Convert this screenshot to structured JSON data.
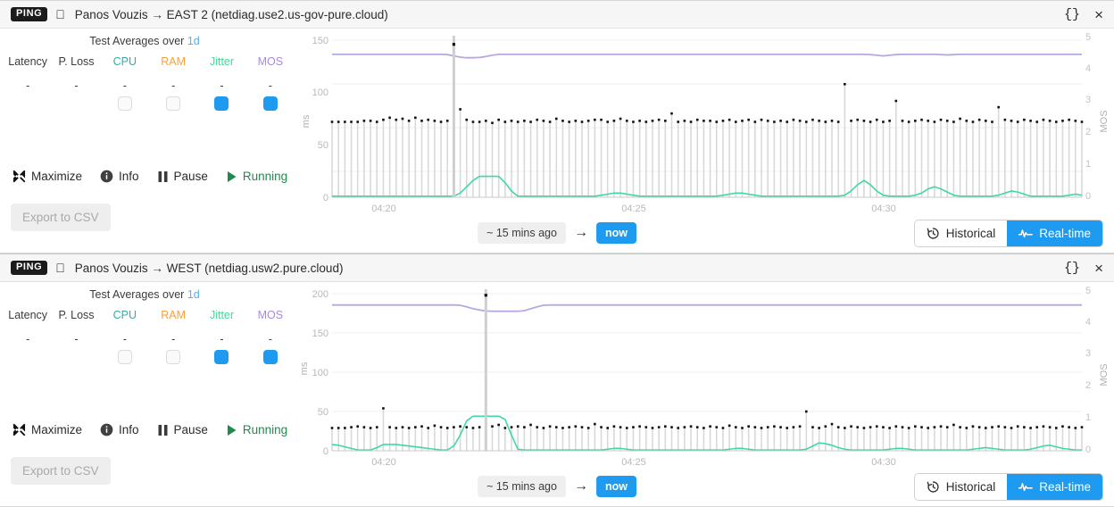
{
  "panels": [
    {
      "titlebar": {
        "badge": "PING",
        "os_icon": "apple-icon",
        "title": "Panos Vouzis → EAST 2 (netdiag.use2.us-gov-pure.cloud)",
        "json_button": "{}",
        "close_button": "×"
      },
      "averages": {
        "label_prefix": "Test Averages over",
        "duration": "1d",
        "columns": [
          {
            "label": "Latency",
            "color": "#3b3b3b",
            "value": "-",
            "checkbox": null
          },
          {
            "label": "P. Loss",
            "color": "#3b3b3b",
            "value": "-",
            "checkbox": null
          },
          {
            "label": "CPU",
            "color": "#3aa8a8",
            "value": "-",
            "checkbox": "off"
          },
          {
            "label": "RAM",
            "color": "#f6a13c",
            "value": "-",
            "checkbox": "off"
          },
          {
            "label": "Jitter",
            "color": "#42d99a",
            "value": "-",
            "checkbox": "on"
          },
          {
            "label": "MOS",
            "color": "#a98ae0",
            "value": "-",
            "checkbox": "on"
          }
        ]
      },
      "actions": [
        {
          "icon": "maximize-icon",
          "label": "Maximize",
          "state": "normal"
        },
        {
          "icon": "info-icon",
          "label": "Info",
          "state": "normal"
        },
        {
          "icon": "pause-icon",
          "label": "Pause",
          "state": "normal"
        },
        {
          "icon": "play-icon",
          "label": "Running",
          "state": "running"
        }
      ],
      "export_label": "Export to CSV",
      "footer": {
        "time_from": "~ 15 mins ago",
        "arrow": "→",
        "time_to": "now",
        "historical_label": "Historical",
        "historical_icon": "history-clock-icon",
        "realtime_label": "Real-time",
        "realtime_icon": "pulse-icon",
        "active_mode": "Real-time"
      },
      "chart_data": {
        "type": "line",
        "title": "",
        "xlabel": "",
        "ylabel": "ms",
        "y2label": "MOS",
        "ylim": [
          0,
          150
        ],
        "y2lim": [
          0,
          5
        ],
        "yticks": [
          0,
          50,
          100,
          150
        ],
        "y2ticks": [
          0,
          1,
          2,
          3,
          4,
          5
        ],
        "xticks": [
          "04:20",
          "04:25",
          "04:30"
        ],
        "grid": true,
        "legend_position": "none",
        "series": [
          {
            "name": "Latency",
            "color": "#d9d9d9",
            "marker_color": "#111111",
            "type": "stem",
            "values": [
              72,
              72,
              72,
              72,
              72,
              73,
              73,
              72,
              74,
              76,
              74,
              75,
              73,
              76,
              73,
              74,
              73,
              72,
              73,
              146,
              84,
              74,
              72,
              72,
              73,
              71,
              74,
              72,
              73,
              72,
              73,
              72,
              74,
              73,
              72,
              75,
              73,
              72,
              73,
              72,
              73,
              74,
              74,
              72,
              73,
              75,
              73,
              72,
              73,
              72,
              73,
              74,
              73,
              80,
              72,
              73,
              72,
              74,
              73,
              73,
              72,
              73,
              74,
              72,
              73,
              74,
              72,
              74,
              73,
              72,
              73,
              72,
              74,
              73,
              72,
              74,
              73,
              72,
              73,
              72,
              108,
              73,
              74,
              73,
              72,
              74,
              72,
              73,
              92,
              73,
              72,
              73,
              74,
              73,
              72,
              74,
              73,
              72,
              75,
              73,
              72,
              74,
              73,
              72,
              86,
              74,
              73,
              72,
              74,
              73,
              72,
              74,
              73,
              72,
              73,
              74,
              73,
              72
            ]
          },
          {
            "name": "MOS",
            "color": "#b9a8e0",
            "type": "line",
            "values": [
              4.55,
              4.55,
              4.55,
              4.55,
              4.55,
              4.55,
              4.55,
              4.55,
              4.55,
              4.55,
              4.55,
              4.55,
              4.55,
              4.55,
              4.55,
              4.55,
              4.55,
              4.55,
              4.54,
              4.5,
              4.46,
              4.44,
              4.44,
              4.45,
              4.48,
              4.52,
              4.55,
              4.55,
              4.55,
              4.55,
              4.55,
              4.55,
              4.55,
              4.55,
              4.55,
              4.55,
              4.55,
              4.55,
              4.55,
              4.55,
              4.55,
              4.55,
              4.55,
              4.55,
              4.55,
              4.55,
              4.55,
              4.55,
              4.55,
              4.55,
              4.55,
              4.55,
              4.55,
              4.55,
              4.55,
              4.55,
              4.55,
              4.55,
              4.55,
              4.55,
              4.55,
              4.55,
              4.55,
              4.55,
              4.55,
              4.55,
              4.55,
              4.55,
              4.55,
              4.55,
              4.55,
              4.55,
              4.55,
              4.55,
              4.55,
              4.55,
              4.55,
              4.55,
              4.55,
              4.55,
              4.55,
              4.55,
              4.55,
              4.55,
              4.54,
              4.52,
              4.5,
              4.52,
              4.54,
              4.55,
              4.55,
              4.55,
              4.55,
              4.55,
              4.55,
              4.54,
              4.53,
              4.54,
              4.55,
              4.55,
              4.55,
              4.55,
              4.55,
              4.55,
              4.55,
              4.55,
              4.55,
              4.55,
              4.55,
              4.55,
              4.55,
              4.55,
              4.55,
              4.55,
              4.55,
              4.55,
              4.55,
              4.55
            ]
          },
          {
            "name": "Jitter",
            "color": "#3fd9a0",
            "type": "line",
            "values": [
              1,
              1,
              1,
              1,
              1,
              1,
              1,
              1,
              1,
              1,
              1,
              1,
              1,
              1,
              1,
              1,
              1,
              1,
              1,
              1,
              4,
              10,
              16,
              20,
              20,
              20,
              20,
              14,
              6,
              1,
              1,
              1,
              1,
              1,
              1,
              1,
              1,
              1,
              1,
              1,
              1,
              1,
              2,
              3,
              4,
              4,
              3,
              2,
              1,
              1,
              1,
              1,
              1,
              1,
              1,
              1,
              1,
              1,
              1,
              1,
              1,
              2,
              3,
              4,
              4,
              3,
              2,
              1,
              1,
              1,
              1,
              1,
              1,
              1,
              1,
              1,
              1,
              1,
              1,
              1,
              2,
              6,
              12,
              16,
              12,
              6,
              2,
              1,
              1,
              1,
              1,
              2,
              4,
              8,
              10,
              8,
              5,
              2,
              1,
              1,
              1,
              1,
              1,
              1,
              2,
              4,
              6,
              5,
              3,
              1,
              1,
              1,
              1,
              1,
              1,
              2,
              3,
              2
            ]
          }
        ]
      }
    },
    {
      "titlebar": {
        "badge": "PING",
        "os_icon": "apple-icon",
        "title": "Panos Vouzis → WEST (netdiag.usw2.pure.cloud)",
        "json_button": "{}",
        "close_button": "×"
      },
      "averages": {
        "label_prefix": "Test Averages over",
        "duration": "1d",
        "columns": [
          {
            "label": "Latency",
            "color": "#3b3b3b",
            "value": "-",
            "checkbox": null
          },
          {
            "label": "P. Loss",
            "color": "#3b3b3b",
            "value": "-",
            "checkbox": null
          },
          {
            "label": "CPU",
            "color": "#3aa8a8",
            "value": "-",
            "checkbox": "off"
          },
          {
            "label": "RAM",
            "color": "#f6a13c",
            "value": "-",
            "checkbox": "off"
          },
          {
            "label": "Jitter",
            "color": "#42d99a",
            "value": "-",
            "checkbox": "on"
          },
          {
            "label": "MOS",
            "color": "#a98ae0",
            "value": "-",
            "checkbox": "on"
          }
        ]
      },
      "actions": [
        {
          "icon": "maximize-icon",
          "label": "Maximize",
          "state": "normal"
        },
        {
          "icon": "info-icon",
          "label": "Info",
          "state": "normal"
        },
        {
          "icon": "pause-icon",
          "label": "Pause",
          "state": "normal"
        },
        {
          "icon": "play-icon",
          "label": "Running",
          "state": "running"
        }
      ],
      "export_label": "Export to CSV",
      "footer": {
        "time_from": "~ 15 mins ago",
        "arrow": "→",
        "time_to": "now",
        "historical_label": "Historical",
        "historical_icon": "history-clock-icon",
        "realtime_label": "Real-time",
        "realtime_icon": "pulse-icon",
        "active_mode": "Real-time"
      },
      "chart_data": {
        "type": "line",
        "title": "",
        "xlabel": "",
        "ylabel": "ms",
        "y2label": "MOS",
        "ylim": [
          0,
          200
        ],
        "y2lim": [
          0,
          5
        ],
        "yticks": [
          0,
          50,
          100,
          150,
          200
        ],
        "y2ticks": [
          0,
          1,
          2,
          3,
          4,
          5
        ],
        "xticks": [
          "04:20",
          "04:25",
          "04:30"
        ],
        "grid": true,
        "legend_position": "none",
        "series": [
          {
            "name": "Latency",
            "color": "#d9d9d9",
            "marker_color": "#111111",
            "type": "stem",
            "values": [
              29,
              29,
              29,
              30,
              31,
              30,
              29,
              30,
              54,
              30,
              29,
              30,
              29,
              30,
              31,
              29,
              32,
              30,
              29,
              30,
              31,
              30,
              29,
              30,
              198,
              31,
              33,
              29,
              30,
              31,
              30,
              33,
              30,
              29,
              31,
              30,
              29,
              30,
              31,
              30,
              29,
              34,
              30,
              29,
              31,
              30,
              29,
              30,
              31,
              30,
              29,
              30,
              31,
              30,
              29,
              30,
              31,
              30,
              29,
              31,
              30,
              29,
              32,
              30,
              29,
              31,
              30,
              29,
              30,
              31,
              30,
              29,
              30,
              31,
              50,
              30,
              29,
              31,
              34,
              30,
              29,
              31,
              30,
              29,
              30,
              31,
              30,
              29,
              31,
              30,
              29,
              31,
              30,
              29,
              30,
              31,
              30,
              33,
              30,
              29,
              31,
              30,
              29,
              30,
              31,
              30,
              29,
              31,
              30,
              29,
              30,
              31,
              30,
              29,
              31,
              30,
              29,
              30
            ]
          },
          {
            "name": "MOS",
            "color": "#b9a8e0",
            "type": "line",
            "values": [
              4.64,
              4.64,
              4.64,
              4.64,
              4.64,
              4.64,
              4.64,
              4.64,
              4.64,
              4.64,
              4.64,
              4.64,
              4.64,
              4.64,
              4.64,
              4.64,
              4.64,
              4.64,
              4.64,
              4.64,
              4.63,
              4.58,
              4.52,
              4.48,
              4.45,
              4.44,
              4.44,
              4.44,
              4.44,
              4.44,
              4.46,
              4.52,
              4.58,
              4.63,
              4.64,
              4.64,
              4.64,
              4.64,
              4.64,
              4.64,
              4.64,
              4.64,
              4.64,
              4.64,
              4.64,
              4.64,
              4.64,
              4.64,
              4.64,
              4.64,
              4.64,
              4.64,
              4.64,
              4.64,
              4.64,
              4.64,
              4.64,
              4.64,
              4.64,
              4.64,
              4.64,
              4.64,
              4.64,
              4.64,
              4.64,
              4.64,
              4.64,
              4.64,
              4.64,
              4.64,
              4.64,
              4.64,
              4.64,
              4.64,
              4.64,
              4.64,
              4.64,
              4.64,
              4.64,
              4.64,
              4.64,
              4.64,
              4.64,
              4.64,
              4.64,
              4.64,
              4.64,
              4.64,
              4.64,
              4.64,
              4.64,
              4.64,
              4.64,
              4.64,
              4.64,
              4.64,
              4.64,
              4.64,
              4.64,
              4.64,
              4.64,
              4.64,
              4.64,
              4.64,
              4.64,
              4.64,
              4.64,
              4.64,
              4.64,
              4.64,
              4.64,
              4.64,
              4.64,
              4.64,
              4.64,
              4.64,
              4.64,
              4.64
            ]
          },
          {
            "name": "Jitter",
            "color": "#3fd9a0",
            "type": "line",
            "values": [
              8,
              7,
              5,
              3,
              1,
              1,
              1,
              4,
              8,
              8,
              8,
              7,
              6,
              5,
              4,
              3,
              2,
              1,
              1,
              6,
              20,
              38,
              44,
              44,
              44,
              44,
              44,
              40,
              20,
              2,
              1,
              1,
              1,
              1,
              1,
              1,
              1,
              1,
              1,
              1,
              1,
              1,
              1,
              2,
              3,
              3,
              2,
              1,
              1,
              1,
              1,
              1,
              1,
              1,
              1,
              1,
              1,
              1,
              1,
              1,
              1,
              1,
              2,
              3,
              3,
              2,
              1,
              1,
              1,
              1,
              1,
              1,
              1,
              1,
              2,
              6,
              10,
              9,
              7,
              4,
              2,
              1,
              1,
              1,
              1,
              1,
              1,
              2,
              3,
              3,
              2,
              1,
              1,
              1,
              1,
              1,
              1,
              1,
              1,
              1,
              2,
              3,
              4,
              3,
              2,
              1,
              1,
              1,
              1,
              2,
              4,
              6,
              7,
              5,
              3,
              2,
              1,
              1
            ]
          }
        ]
      }
    }
  ]
}
